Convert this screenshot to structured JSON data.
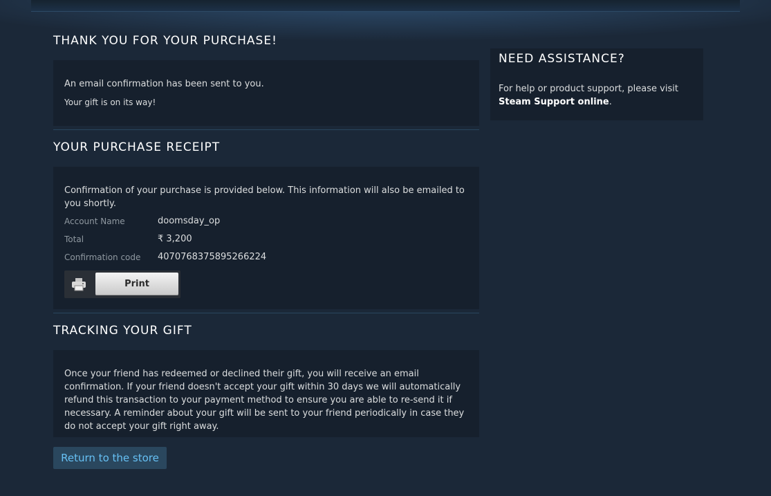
{
  "thankyou": {
    "heading": "THANK YOU FOR YOUR PURCHASE!",
    "line1": "An email confirmation has been sent to you.",
    "line2": "Your gift is on its way!"
  },
  "receipt": {
    "heading": "YOUR PURCHASE RECEIPT",
    "intro": "Confirmation of your purchase is provided below. This information will also be emailed to you shortly.",
    "rows": [
      {
        "label": "Account Name",
        "value": "doomsday_op"
      },
      {
        "label": "Total",
        "value": "₹ 3,200"
      },
      {
        "label": "Confirmation code",
        "value": "4070768375895266224"
      }
    ],
    "print_label": "Print",
    "print_icon": "printer-icon"
  },
  "tracking": {
    "heading": "TRACKING YOUR GIFT",
    "text": "Once your friend has redeemed or declined their gift, you will receive an email confirmation. If your friend doesn't accept your gift within 30 days we will automatically refund this transaction to your payment method to ensure you are able to re-send it if necessary. A reminder about your gift will be sent to your friend periodically in case they do not accept your gift right away."
  },
  "return_button": "Return to the store",
  "assistance": {
    "heading": "NEED ASSISTANCE?",
    "text_before": "For help or product support, please visit ",
    "link": "Steam Support online",
    "text_after": "."
  },
  "colors": {
    "background": "#1b2838",
    "panel": "#16202d",
    "link": "#66c0f4",
    "button": "#2a475e"
  }
}
